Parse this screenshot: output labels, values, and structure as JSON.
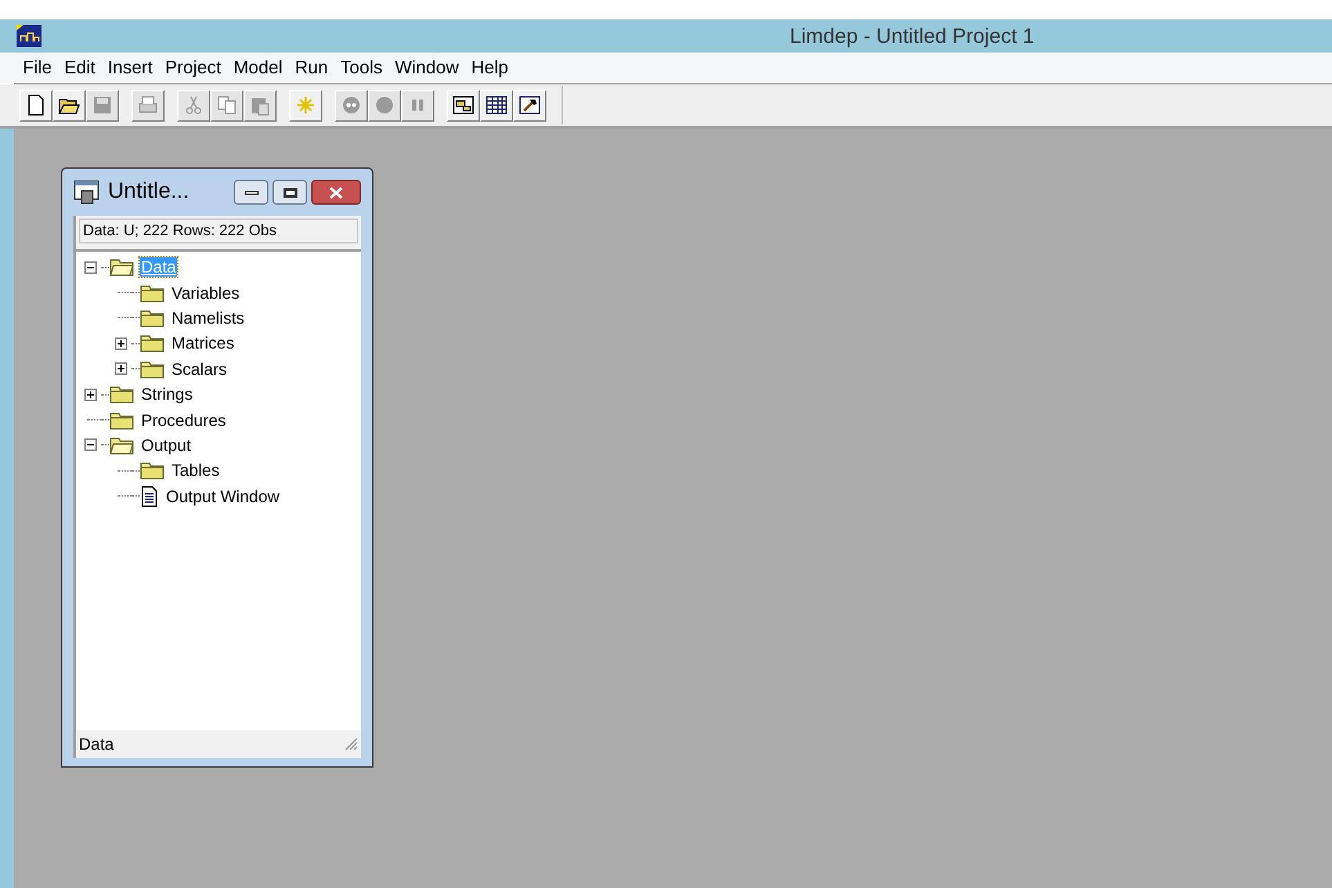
{
  "window": {
    "title": "Limdep - Untitled Project 1"
  },
  "menu": [
    "File",
    "Edit",
    "Insert",
    "Project",
    "Model",
    "Run",
    "Tools",
    "Window",
    "Help"
  ],
  "toolbar": [
    [
      {
        "kind": "new",
        "disabled": false
      },
      {
        "kind": "open",
        "disabled": false
      },
      {
        "kind": "save",
        "disabled": true
      }
    ],
    [
      {
        "kind": "print",
        "disabled": true
      }
    ],
    [
      {
        "kind": "cut",
        "disabled": true
      },
      {
        "kind": "copy",
        "disabled": true
      },
      {
        "kind": "paste",
        "disabled": true
      }
    ],
    [
      {
        "kind": "spark",
        "disabled": false
      }
    ],
    [
      {
        "kind": "record",
        "disabled": true
      },
      {
        "kind": "stop",
        "disabled": true
      },
      {
        "kind": "pause",
        "disabled": true
      }
    ],
    [
      {
        "kind": "project",
        "disabled": false
      },
      {
        "kind": "grid",
        "disabled": false
      },
      {
        "kind": "hammer",
        "disabled": false
      }
    ]
  ],
  "project_window": {
    "title": "Untitle...",
    "info": "Data: U; 222 Rows: 222 Obs",
    "status": "Data",
    "tree": [
      {
        "label": "Data",
        "kind": "folder",
        "expanded": true,
        "selected": true,
        "children": [
          {
            "label": "Variables",
            "kind": "folder",
            "selected": false
          },
          {
            "label": "Namelists",
            "kind": "folder",
            "selected": false
          },
          {
            "label": "Matrices",
            "kind": "folder",
            "expanded": false,
            "selected": false
          },
          {
            "label": "Scalars",
            "kind": "folder",
            "expanded": false,
            "selected": false
          }
        ]
      },
      {
        "label": "Strings",
        "kind": "folder",
        "expanded": false,
        "selected": false
      },
      {
        "label": "Procedures",
        "kind": "folder",
        "selected": false
      },
      {
        "label": "Output",
        "kind": "folder",
        "expanded": true,
        "selected": false,
        "children": [
          {
            "label": "Tables",
            "kind": "folder",
            "selected": false
          },
          {
            "label": "Output Window",
            "kind": "document",
            "selected": false
          }
        ]
      }
    ]
  }
}
